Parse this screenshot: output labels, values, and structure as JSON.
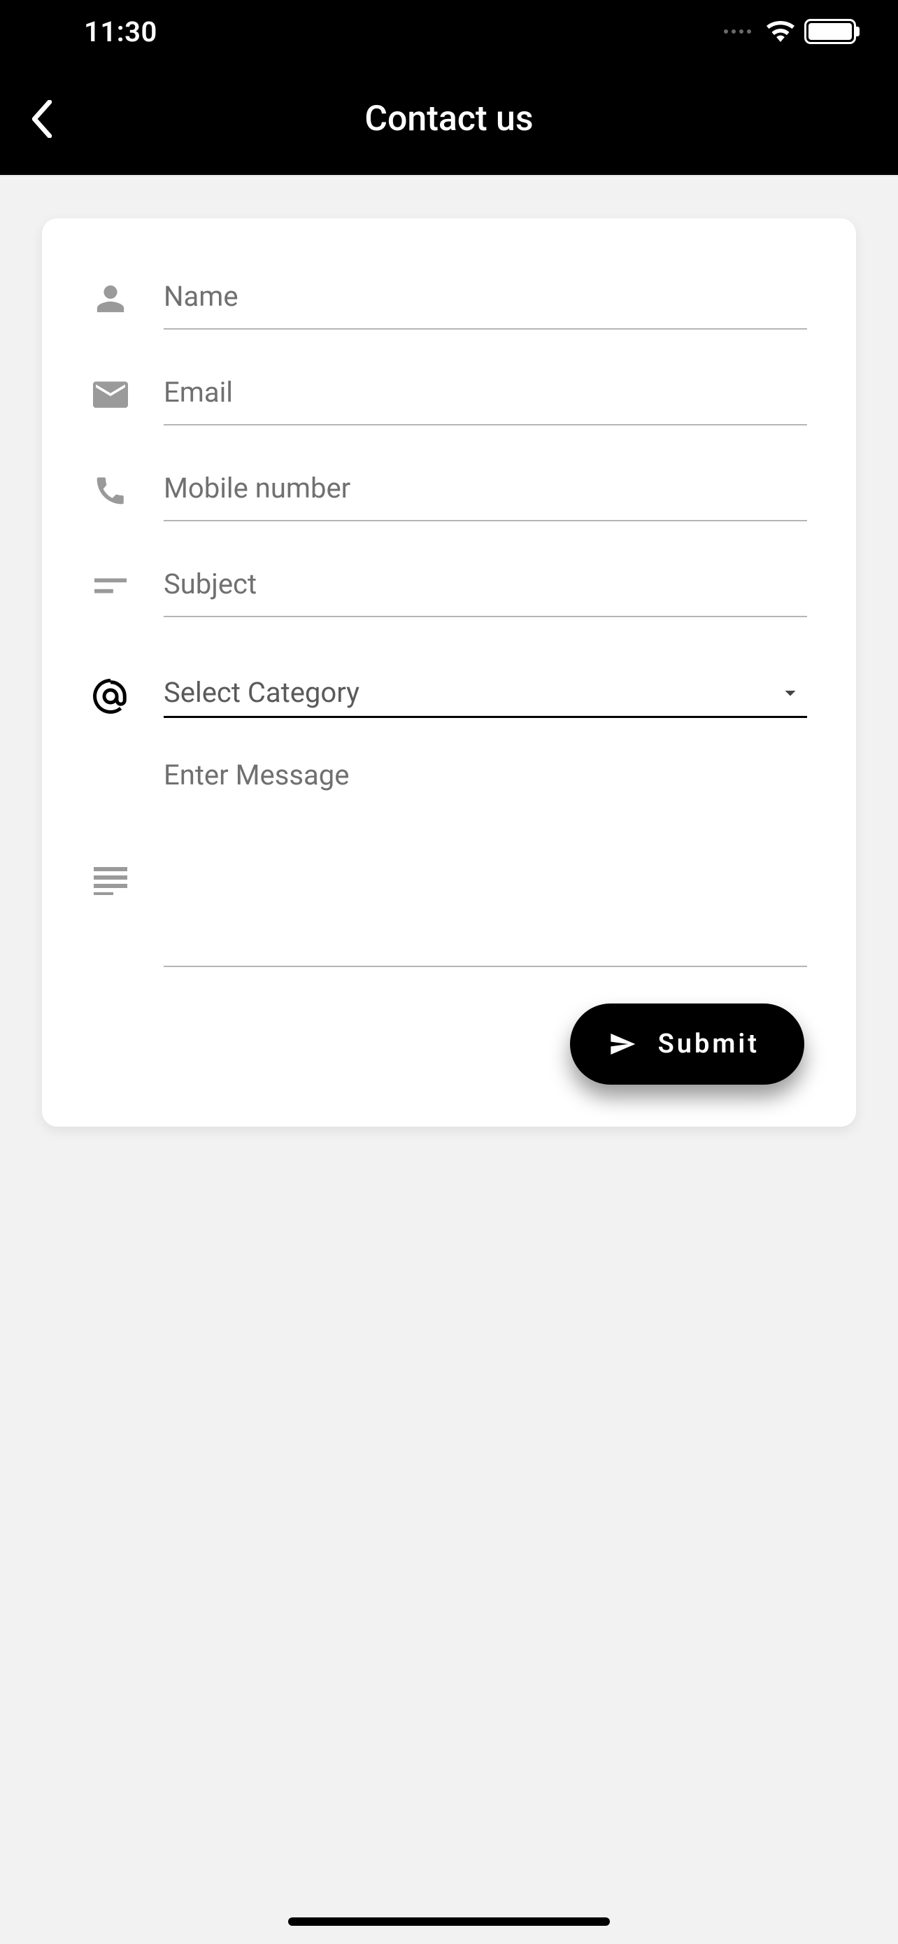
{
  "status": {
    "time": "11:30"
  },
  "header": {
    "title": "Contact us"
  },
  "form": {
    "name": {
      "placeholder": "Name",
      "value": ""
    },
    "email": {
      "placeholder": "Email",
      "value": ""
    },
    "mobile": {
      "placeholder": "Mobile number",
      "value": ""
    },
    "subject": {
      "placeholder": "Subject",
      "value": ""
    },
    "category": {
      "placeholder": "Select Category"
    },
    "message": {
      "placeholder": "Enter Message",
      "value": ""
    }
  },
  "submit": {
    "label": "Submit"
  }
}
